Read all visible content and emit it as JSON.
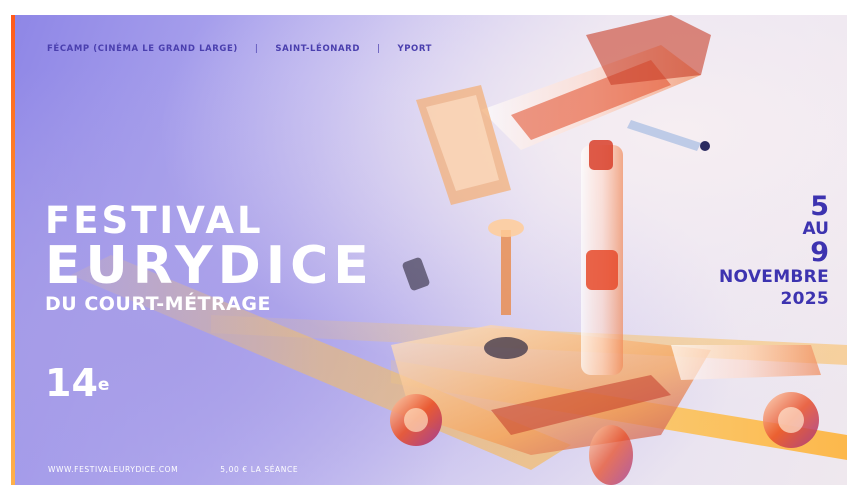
{
  "poster": {
    "locations": [
      "FÉCAMP (CINÉMA LE GRAND LARGE)",
      "SAINT-LÉONARD",
      "YPORT"
    ],
    "separator": "|",
    "title": {
      "line1": "FESTIVAL",
      "line2": "EURYDICE",
      "line3": "DU COURT-MÉTRAGE"
    },
    "edition": {
      "number": "14",
      "suffix": "e"
    },
    "dates": {
      "start": "5",
      "connector": "AU",
      "end": "9",
      "month": "NOVEMBRE",
      "year": "2025"
    },
    "footer": {
      "website": "WWW.FESTIVALEURYDICE.COM",
      "price": "5,00 € LA SÉANCE"
    }
  },
  "colors": {
    "accent": "#3d33b0",
    "edge_bar": "#ff6a1f",
    "title": "#ffffff"
  }
}
